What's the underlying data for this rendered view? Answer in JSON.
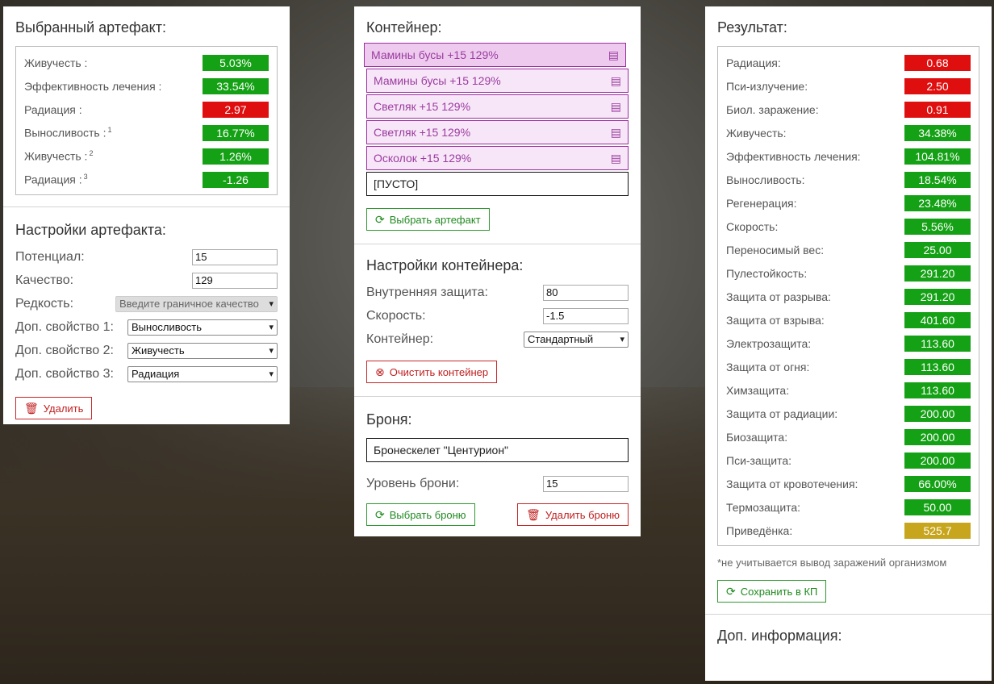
{
  "artifact": {
    "title": "Выбранный артефакт:",
    "stats": [
      {
        "label": "Живучесть :",
        "sup": "",
        "value": "5.03%",
        "color": "g"
      },
      {
        "label": "Эффективность лечения :",
        "sup": "",
        "value": "33.54%",
        "color": "g"
      },
      {
        "label": "Радиация :",
        "sup": "",
        "value": "2.97",
        "color": "r"
      },
      {
        "label": "Выносливость :",
        "sup": "1",
        "value": "16.77%",
        "color": "g"
      },
      {
        "label": "Живучесть :",
        "sup": "2",
        "value": "1.26%",
        "color": "g"
      },
      {
        "label": "Радиация :",
        "sup": "3",
        "value": "-1.26",
        "color": "g"
      }
    ]
  },
  "artifact_settings": {
    "title": "Настройки артефакта:",
    "potential_label": "Потенциал:",
    "potential_value": "15",
    "quality_label": "Качество:",
    "quality_value": "129",
    "rarity_label": "Редкость:",
    "rarity_value": "Введите граничное качество",
    "prop1_label": "Доп. свойство 1:",
    "prop1_value": "Выносливость",
    "prop2_label": "Доп. свойство 2:",
    "prop2_value": "Живучесть",
    "prop3_label": "Доп. свойство 3:",
    "prop3_value": "Радиация",
    "delete_label": "Удалить"
  },
  "container": {
    "title": "Контейнер:",
    "slots": [
      "Мамины бусы +15 129%",
      "Мамины бусы +15 129%",
      "Светляк +15 129%",
      "Светляк +15 129%",
      "Осколок +15 129%"
    ],
    "empty_slot": "[ПУСТО]",
    "select_artifact_label": "Выбрать артефакт"
  },
  "container_settings": {
    "title": "Настройки контейнера:",
    "protection_label": "Внутренняя защита:",
    "protection_value": "80",
    "speed_label": "Скорость:",
    "speed_value": "-1.5",
    "container_label": "Контейнер:",
    "container_value": "Стандартный",
    "clear_label": "Очистить контейнер"
  },
  "armor": {
    "title": "Броня:",
    "armor_name": "Бронескелет \"Центурион\"",
    "level_label": "Уровень брони:",
    "level_value": "15",
    "select_armor_label": "Выбрать броню",
    "delete_armor_label": "Удалить броню"
  },
  "result": {
    "title": "Результат:",
    "stats": [
      {
        "label": "Радиация:",
        "value": "0.68",
        "color": "r"
      },
      {
        "label": "Пси-излучение:",
        "value": "2.50",
        "color": "r"
      },
      {
        "label": "Биол. заражение:",
        "value": "0.91",
        "color": "r"
      },
      {
        "label": "Живучесть:",
        "value": "34.38%",
        "color": "g"
      },
      {
        "label": "Эффективность лечения:",
        "value": "104.81%",
        "color": "g"
      },
      {
        "label": "Выносливость:",
        "value": "18.54%",
        "color": "g"
      },
      {
        "label": "Регенерация:",
        "value": "23.48%",
        "color": "g"
      },
      {
        "label": "Скорость:",
        "value": "5.56%",
        "color": "g"
      },
      {
        "label": "Переносимый вес:",
        "value": "25.00",
        "color": "g"
      },
      {
        "label": "Пулестойкость:",
        "value": "291.20",
        "color": "g"
      },
      {
        "label": "Защита от разрыва:",
        "value": "291.20",
        "color": "g"
      },
      {
        "label": "Защита от взрыва:",
        "value": "401.60",
        "color": "g"
      },
      {
        "label": "Электрозащита:",
        "value": "113.60",
        "color": "g"
      },
      {
        "label": "Защита от огня:",
        "value": "113.60",
        "color": "g"
      },
      {
        "label": "Химзащита:",
        "value": "113.60",
        "color": "g"
      },
      {
        "label": "Защита от радиации:",
        "value": "200.00",
        "color": "g"
      },
      {
        "label": "Биозащита:",
        "value": "200.00",
        "color": "g"
      },
      {
        "label": "Пси-защита:",
        "value": "200.00",
        "color": "g"
      },
      {
        "label": "Защита от кровотечения:",
        "value": "66.00%",
        "color": "g"
      },
      {
        "label": "Термозащита:",
        "value": "50.00",
        "color": "g"
      },
      {
        "label": "Приведёнка:",
        "value": "525.7",
        "color": "y"
      }
    ],
    "note": "*не учитывается вывод заражений организмом",
    "save_label": "Сохранить в КП"
  },
  "extra": {
    "title": "Доп. информация:"
  },
  "colors": {
    "green": "#15a115",
    "red": "#e00f0f",
    "yellow": "#c7a51c",
    "accent_green": "#2e9a2e",
    "accent_red": "#c52a2a",
    "slot_purple": "#9b2ea0"
  }
}
